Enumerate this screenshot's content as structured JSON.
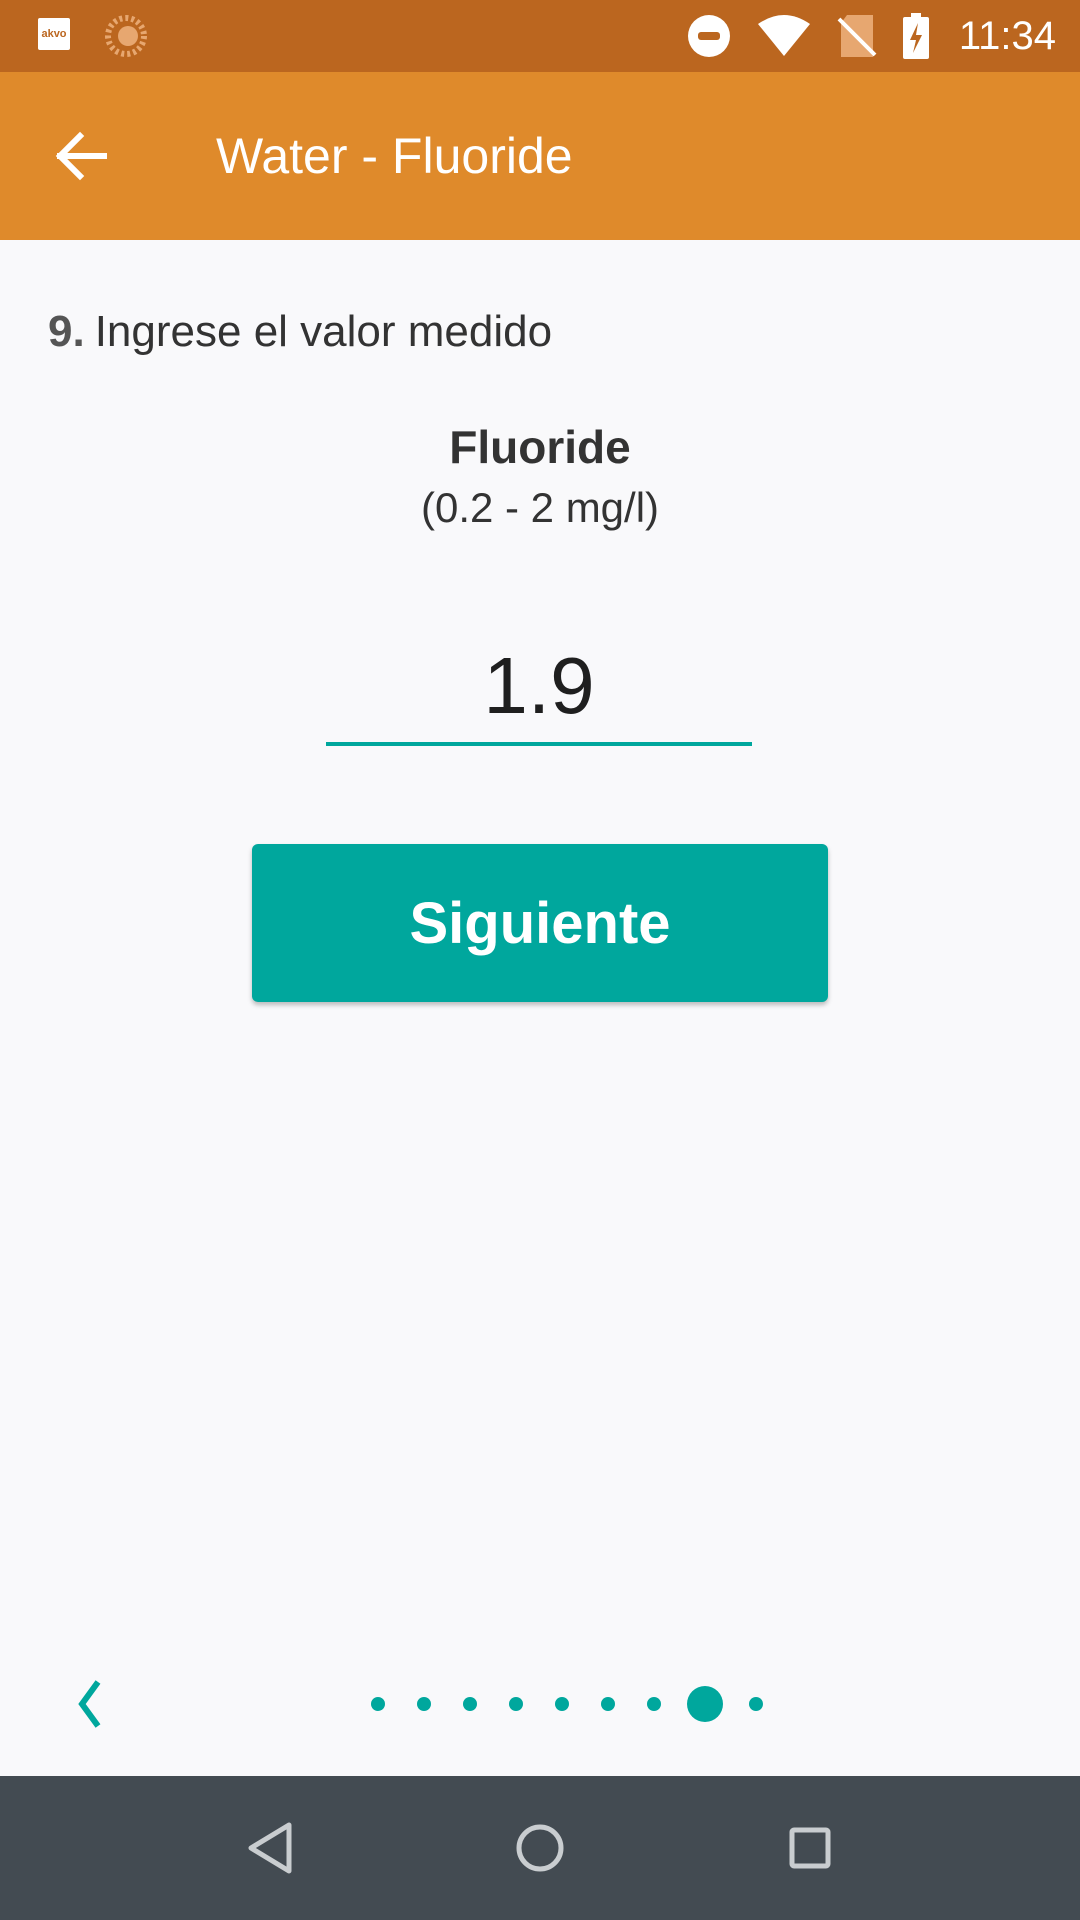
{
  "status_bar": {
    "app_icon_text": "akvo",
    "time": "11:34",
    "icons": [
      "akvo-app-icon",
      "sun-icon",
      "do-not-disturb-icon",
      "wifi-icon",
      "no-sim-icon",
      "battery-charging-icon"
    ]
  },
  "app_bar": {
    "title": "Water - Fluoride",
    "back_icon": "arrow-left-icon"
  },
  "question": {
    "number": "9.",
    "text": "Ingrese el valor medido"
  },
  "parameter": {
    "name": "Fluoride",
    "range": "(0.2 - 2 mg/l)"
  },
  "input": {
    "value": "1.9"
  },
  "next_button": {
    "label": "Siguiente"
  },
  "pager": {
    "total_pages": 9,
    "current_page": 8
  },
  "colors": {
    "status_bar": "#bb661f",
    "app_bar": "#df8a2b",
    "accent": "#00a79d",
    "nav_bar": "#434b52",
    "background": "#f9f9fb"
  },
  "nav_bar": {
    "icons": [
      "nav-back-icon",
      "nav-home-icon",
      "nav-recents-icon"
    ]
  }
}
